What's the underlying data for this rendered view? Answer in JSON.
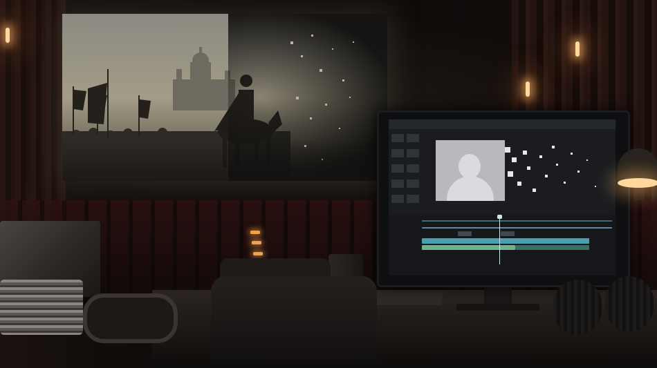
{
  "scene": {
    "description_colors": {
      "warm_light": "#ffd9a0",
      "aisle_light": "#f4a24a",
      "timeline_accent": "#3a6d7a"
    },
    "monitor": {
      "tracks": [
        {
          "color": "#4aa0b0"
        },
        {
          "color": "#6fb38a"
        },
        {
          "color": "#5f8c9a"
        }
      ]
    }
  }
}
